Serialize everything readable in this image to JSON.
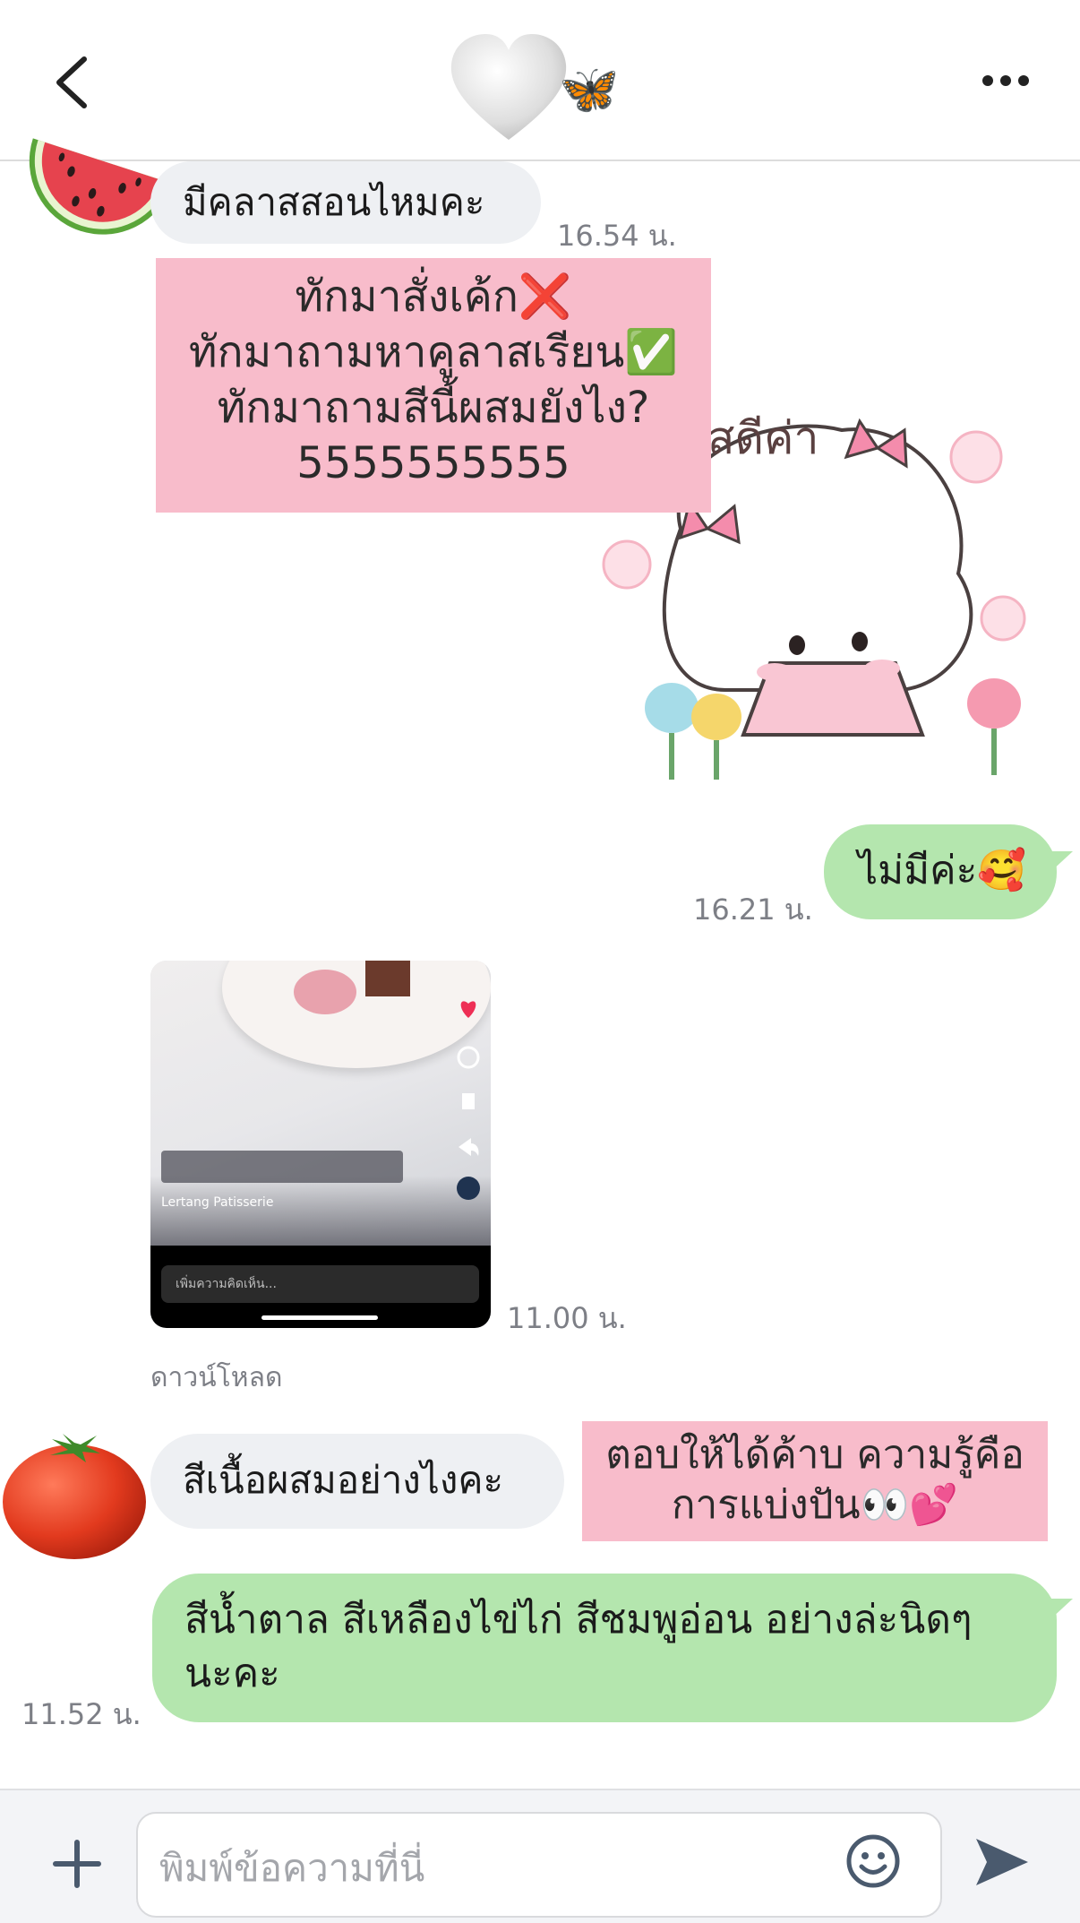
{
  "header": {
    "back_icon": "chevron-left-icon",
    "title_emoji": "🦋",
    "more_icon": "more-horizontal-icon"
  },
  "messages": {
    "m1_text": "มีคลาสสอนไหมคะ",
    "m1_time": "16.54 น.",
    "overlay_line1": "ทักมาสั่งเค้ก❌",
    "overlay_line2": "ทักมาถามหาคูลาสเรียน✅",
    "overlay_line3": "ทักมาถามสีนี้ผสมยังไง?",
    "overlay_line4": "5555555555",
    "sticker_text": "สดีค่า",
    "m2_text": "ไม่มีค่ะ🥰",
    "m2_time": "16.21 น.",
    "video_time": "11.00 น.",
    "video_caption_title": "Lertang Patisserie",
    "video_comment_placeholder": "เพิ่มความคิดเห็น...",
    "download_label": "ดาวน์โหลด",
    "m3_text": "สีเนื้อผสมอย่างไงคะ",
    "overlay2_line1": "ตอบให้ได้ค้าบ ความรู้คือ",
    "overlay2_line2": "การแบ่งปัน👀💕",
    "m4_line1": "สีน้ำตาล สีเหลืองไข่ไก่ สีชมพูอ่อน อย่างล่ะนิดๆ",
    "m4_line2": "นะคะ",
    "m4_time": "11.52 น."
  },
  "input": {
    "placeholder": "พิมพ์ข้อความที่นี่",
    "add_icon": "plus-icon",
    "emoji_icon": "smiley-icon",
    "send_icon": "send-icon"
  },
  "colors": {
    "bubble_in": "#eef0f3",
    "bubble_out": "#b4e6ae",
    "pink_overlay": "#f8bccb"
  }
}
